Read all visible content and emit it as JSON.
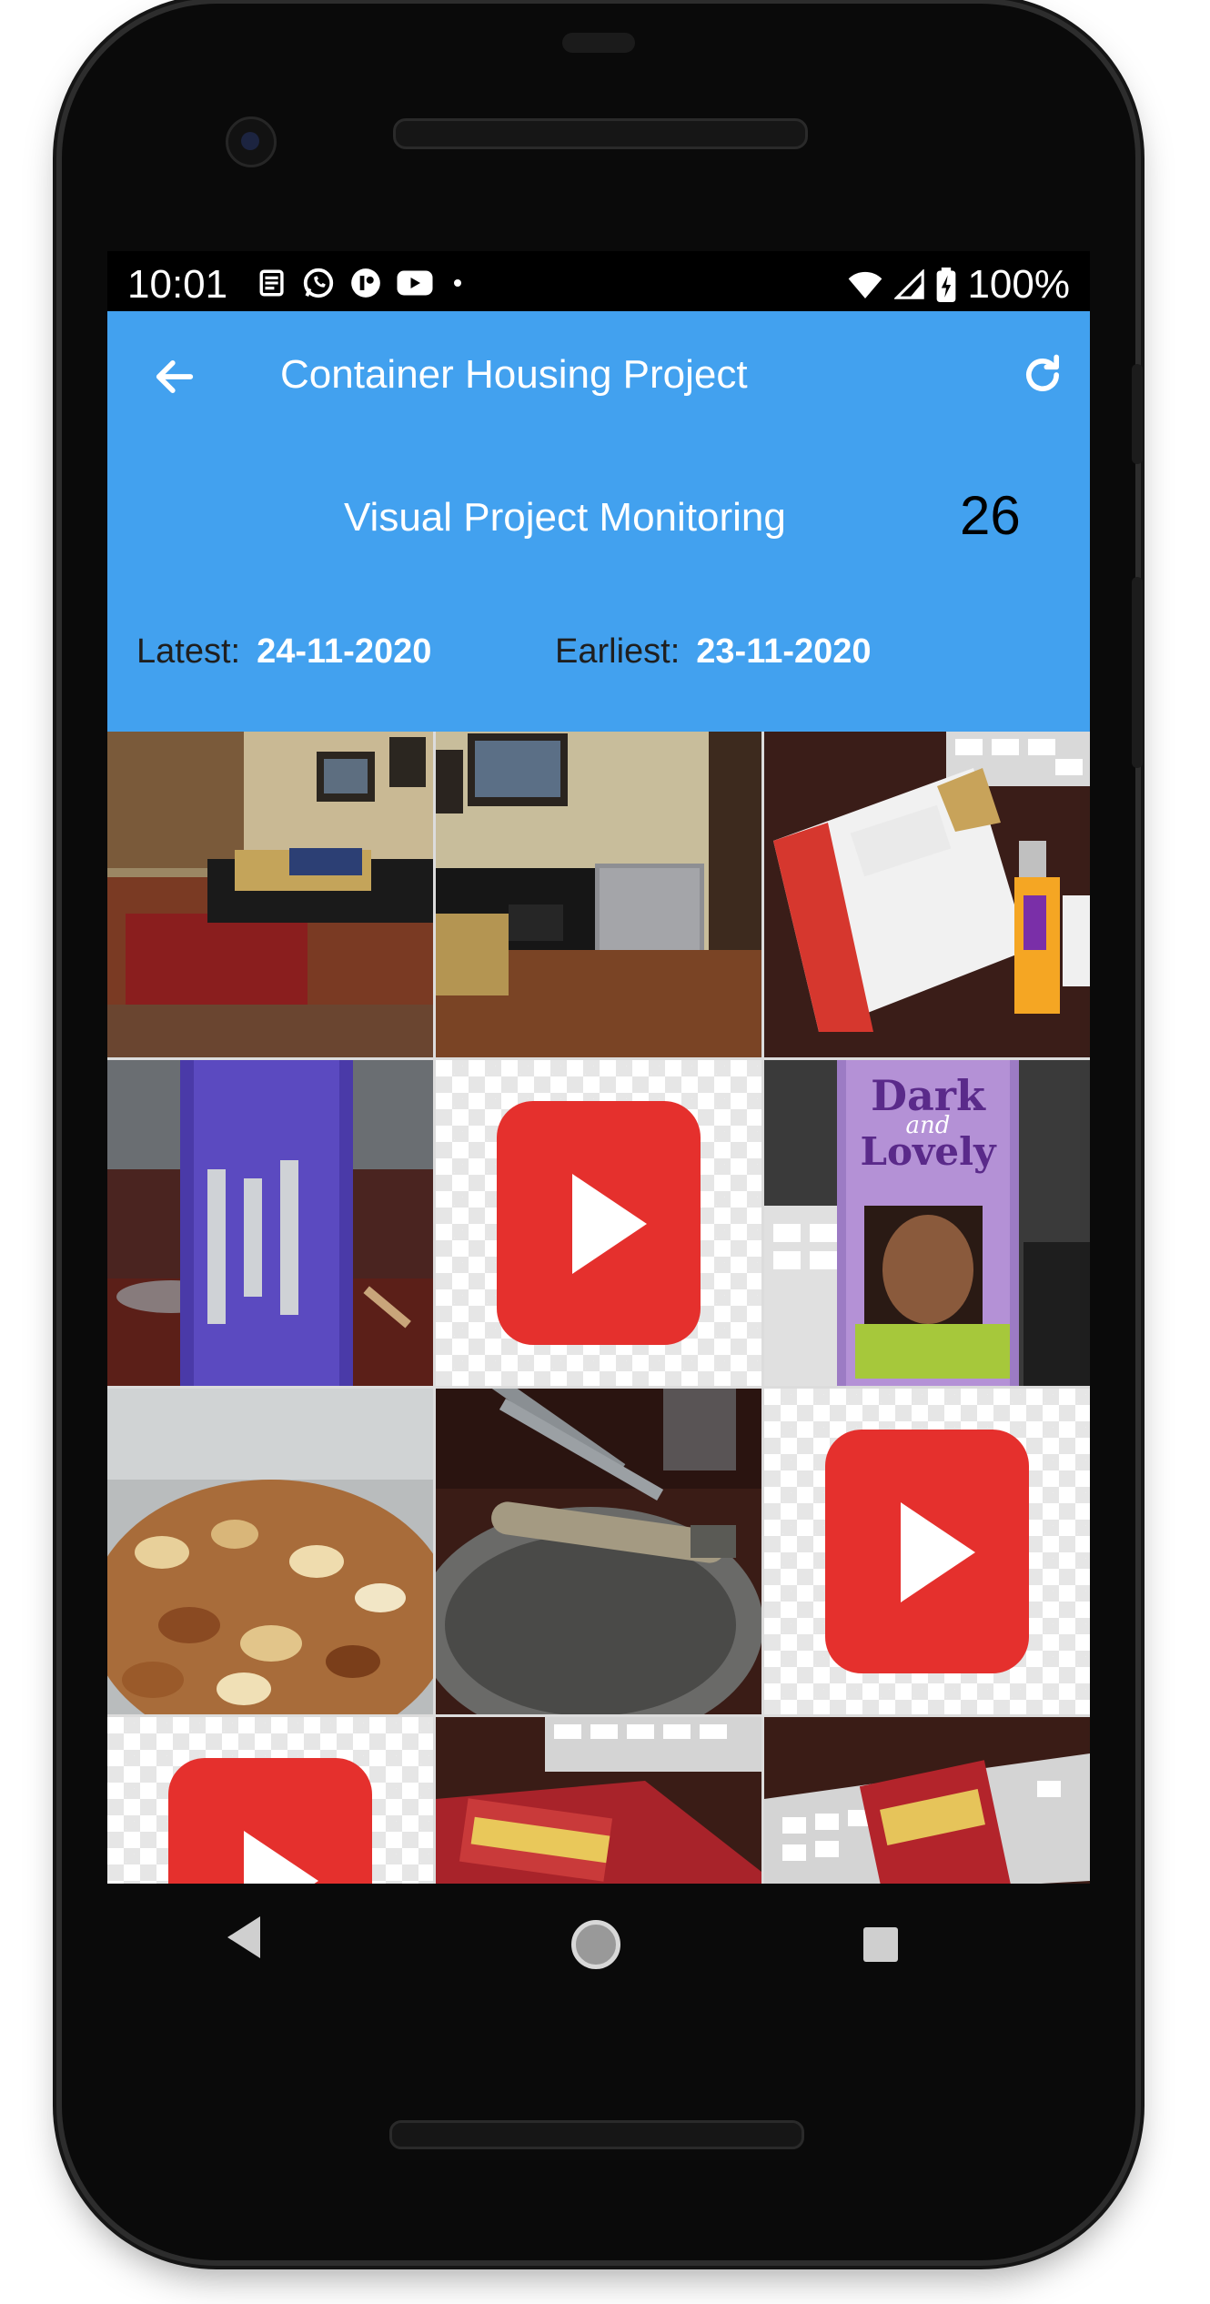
{
  "status_bar": {
    "time": "10:01",
    "battery": "100%",
    "icons_left": [
      "news-icon",
      "whatsapp-icon",
      "messenger-icon",
      "youtube-icon",
      "dot-icon"
    ],
    "icons_right": [
      "wifi-icon",
      "signal-icon",
      "battery-charging-icon"
    ]
  },
  "app_bar": {
    "title": "Container Housing Project",
    "back_icon": "arrow-left-icon",
    "refresh_icon": "refresh-icon",
    "subtitle": "Visual Project Monitoring",
    "count": "26",
    "latest_label": "Latest:",
    "latest_value": "24-11-2020",
    "earliest_label": "Earliest:",
    "earliest_value": "23-11-2020"
  },
  "colors": {
    "app_bar": "#42a1ef",
    "play_red": "#e5302d"
  },
  "gallery": {
    "tiles": [
      {
        "type": "photo",
        "icon": "photo-icon"
      },
      {
        "type": "photo",
        "icon": "photo-icon"
      },
      {
        "type": "photo",
        "icon": "photo-icon"
      },
      {
        "type": "photo",
        "icon": "photo-icon"
      },
      {
        "type": "video",
        "icon": "play-icon"
      },
      {
        "type": "photo",
        "icon": "photo-icon",
        "text_top": "Dark",
        "text_mid": "and",
        "text_bot": "Lovely"
      },
      {
        "type": "photo",
        "icon": "photo-icon"
      },
      {
        "type": "photo",
        "icon": "photo-icon"
      },
      {
        "type": "video",
        "icon": "play-icon"
      },
      {
        "type": "video",
        "icon": "play-icon"
      },
      {
        "type": "photo",
        "icon": "photo-icon"
      },
      {
        "type": "photo",
        "icon": "photo-icon"
      }
    ]
  },
  "nav_bar": {
    "icons": [
      "nav-back-icon",
      "nav-home-icon",
      "nav-recents-icon"
    ]
  }
}
